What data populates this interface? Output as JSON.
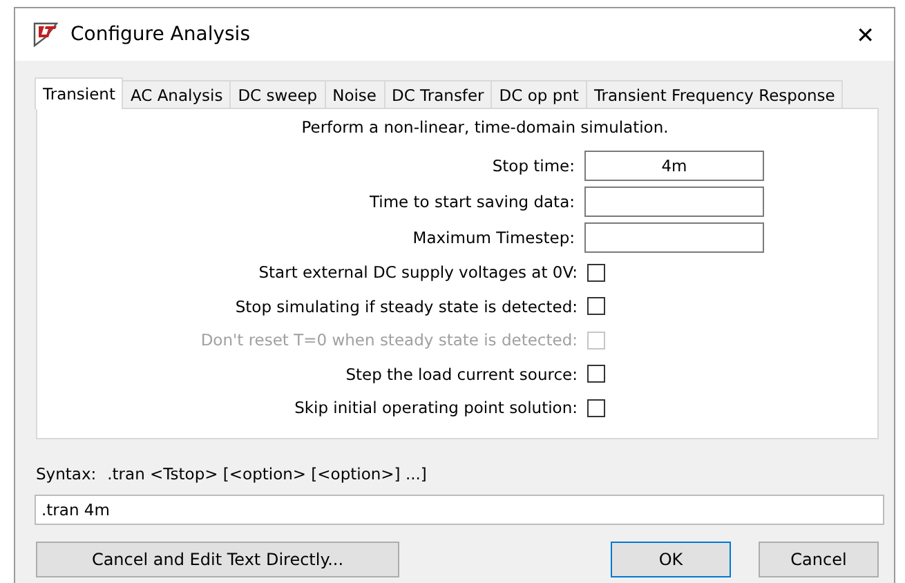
{
  "window": {
    "title": "Configure Analysis",
    "close": "✕"
  },
  "tabs": [
    {
      "label": "Transient",
      "selected": true
    },
    {
      "label": "AC Analysis",
      "selected": false
    },
    {
      "label": "DC sweep",
      "selected": false
    },
    {
      "label": "Noise",
      "selected": false
    },
    {
      "label": "DC Transfer",
      "selected": false
    },
    {
      "label": "DC op pnt",
      "selected": false
    },
    {
      "label": "Transient Frequency Response",
      "selected": false
    }
  ],
  "description": "Perform a non-linear, time-domain simulation.",
  "fields": [
    {
      "kind": "text",
      "label": "Stop time:",
      "value": "4m"
    },
    {
      "kind": "text",
      "label": "Time to start saving data:"
    },
    {
      "kind": "text",
      "label": "Maximum Timestep:"
    },
    {
      "kind": "checkbox",
      "label": "Start external DC supply voltages at 0V:",
      "checked": false,
      "disabled": false
    },
    {
      "kind": "checkbox",
      "label": "Stop simulating if steady state is detected:",
      "checked": false,
      "disabled": false
    },
    {
      "kind": "checkbox",
      "label": "Don't reset T=0 when steady state is detected:",
      "checked": false,
      "disabled": true
    },
    {
      "kind": "checkbox",
      "label": "Step the load current source:",
      "checked": false,
      "disabled": false
    },
    {
      "kind": "checkbox",
      "label": "Skip initial operating point solution:",
      "checked": false,
      "disabled": false
    }
  ],
  "syntax": {
    "label": "Syntax:",
    "text": ".tran <Tstop> [<option> [<option>] ...]"
  },
  "command": ".tran 4m",
  "buttons": [
    {
      "label": "Cancel and Edit Text Directly...",
      "default": false
    },
    {
      "label": "OK",
      "default": true
    },
    {
      "label": "Cancel",
      "default": false
    }
  ]
}
